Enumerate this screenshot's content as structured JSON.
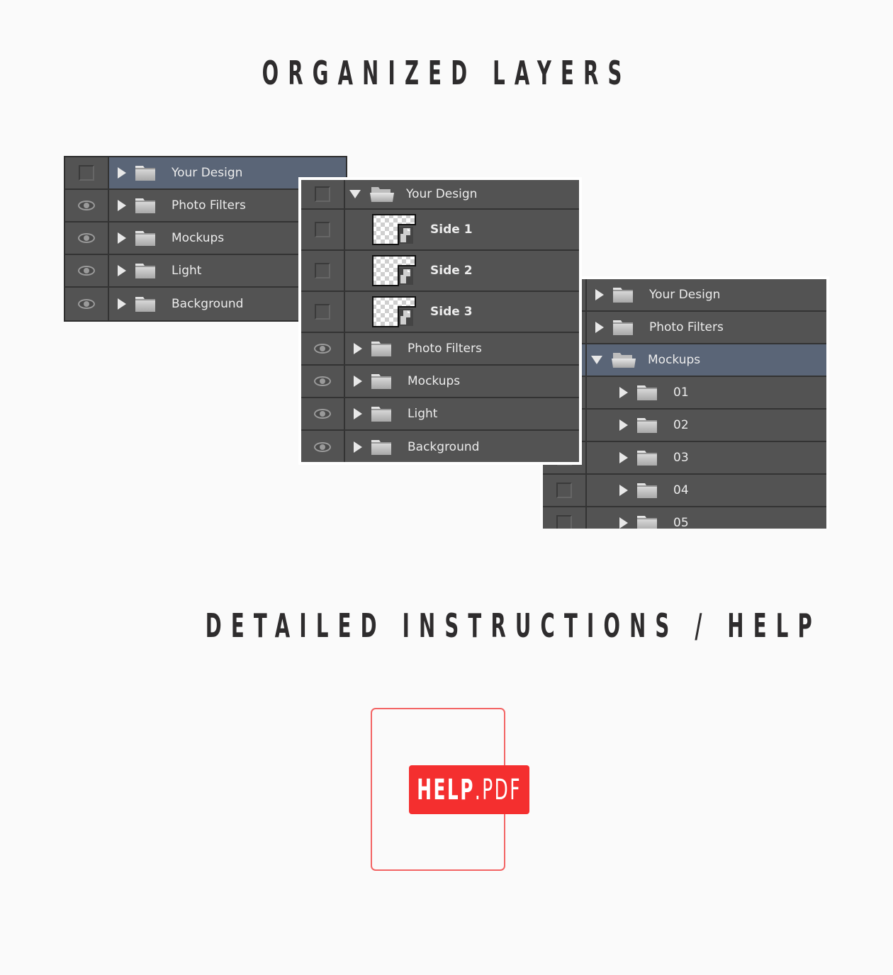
{
  "headings": {
    "layers": "ORGANIZED LAYERS",
    "help": "DETAILED INSTRUCTIONS / HELP"
  },
  "colors": {
    "panel": "#535353",
    "selected": "#5a6577",
    "accent_red": "#f42f2f",
    "background": "#fafafa"
  },
  "panel1": {
    "rows": [
      {
        "label": "Your Design",
        "left": "checkbox",
        "selected": true,
        "expanded": false
      },
      {
        "label": "Photo Filters",
        "left": "eye-icon"
      },
      {
        "label": "Mockups",
        "left": "eye-icon"
      },
      {
        "label": "Light",
        "left": "eye-icon"
      },
      {
        "label": "Background",
        "left": "eye-icon"
      }
    ]
  },
  "panel2": {
    "rows": [
      {
        "label": "Your Design",
        "left": "checkbox",
        "expanded": true
      },
      {
        "label": "Side 1",
        "left": "checkbox",
        "type": "smart-object"
      },
      {
        "label": "Side 2",
        "left": "checkbox",
        "type": "smart-object"
      },
      {
        "label": "Side 3",
        "left": "checkbox",
        "type": "smart-object"
      },
      {
        "label": "Photo Filters",
        "left": "eye-icon"
      },
      {
        "label": "Mockups",
        "left": "eye-icon"
      },
      {
        "label": "Light",
        "left": "eye-icon"
      },
      {
        "label": "Background",
        "left": "eye-icon"
      }
    ]
  },
  "panel3": {
    "rows": [
      {
        "label": "Your Design"
      },
      {
        "label": "Photo Filters"
      },
      {
        "label": "Mockups",
        "selected": true,
        "expanded": true
      },
      {
        "label": "01"
      },
      {
        "label": "02"
      },
      {
        "label": "03"
      },
      {
        "label": "04"
      },
      {
        "label": "05"
      }
    ]
  },
  "help_file": {
    "name": "HELP",
    "extension": ".PDF"
  }
}
